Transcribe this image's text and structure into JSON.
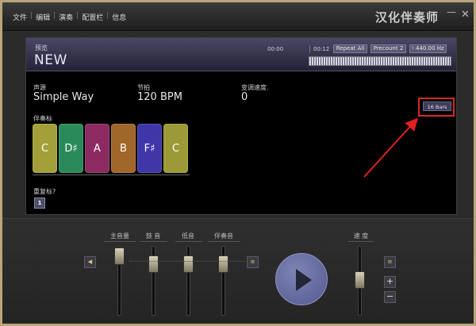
{
  "menu": [
    "文件",
    "编辑",
    "演奏",
    "配置栏",
    "信息"
  ],
  "app_title": "汉化伴奏师",
  "window": {
    "minimize": "—",
    "close": "✕"
  },
  "display": {
    "section_label": "预览",
    "song_name": "NEW",
    "time_start": "00:00",
    "time_end": "00:12",
    "buttons": [
      "Repeat All",
      "Precount 2",
      "♮ 440.00 Hz"
    ],
    "source_label": "声源",
    "source_value": "Simple Way",
    "tempo_label": "节拍",
    "tempo_value": "120 BPM",
    "transpose_label": "变调速度.",
    "transpose_value": "0",
    "bars": "16 Bars",
    "chords_label": "伴奏标",
    "chords": [
      {
        "name": "C",
        "color": "#a3a03a"
      },
      {
        "name": "D♯",
        "color": "#2a8a5a"
      },
      {
        "name": "A",
        "color": "#8e2a62"
      },
      {
        "name": "B",
        "color": "#a0662a"
      },
      {
        "name": "F♯",
        "color": "#3f36a8"
      },
      {
        "name": "C",
        "color": "#9c9a36"
      }
    ],
    "repeat_label": "重复标?",
    "repeat_value": "1"
  },
  "mixer": {
    "labels": [
      "主音量",
      "鼓 音",
      "低音",
      "伴奏音",
      "速 度"
    ]
  },
  "icons": {
    "left_speaker": "speaker-icon",
    "right_speaker": "speaker-icon",
    "tempo_speaker": "speaker-icon",
    "plus": "+",
    "minus": "−"
  }
}
